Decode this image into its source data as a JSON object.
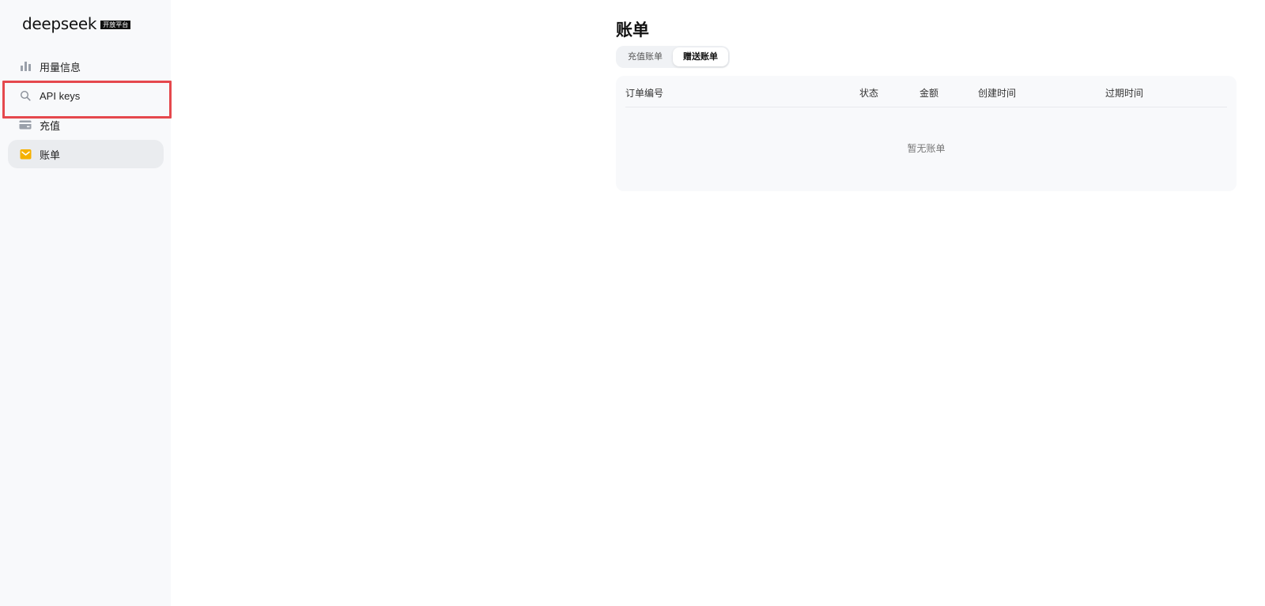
{
  "brand": {
    "name": "deepseek",
    "badge": "开放平台"
  },
  "sidebar": {
    "items": [
      {
        "label": "用量信息",
        "icon": "bar-chart-icon"
      },
      {
        "label": "API keys",
        "icon": "search-icon"
      },
      {
        "label": "充值",
        "icon": "card-icon"
      },
      {
        "label": "账单",
        "icon": "bill-icon"
      }
    ]
  },
  "main": {
    "title": "账单",
    "tabs": [
      {
        "label": "充值账单"
      },
      {
        "label": "赠送账单"
      }
    ],
    "table": {
      "columns": [
        "订单编号",
        "状态",
        "金额",
        "创建时间",
        "过期时间"
      ],
      "empty_text": "暂无账单"
    }
  },
  "colors": {
    "highlight_border": "#e5484d",
    "active_icon": "#f5b100",
    "sidebar_bg": "#f8f9fb"
  }
}
